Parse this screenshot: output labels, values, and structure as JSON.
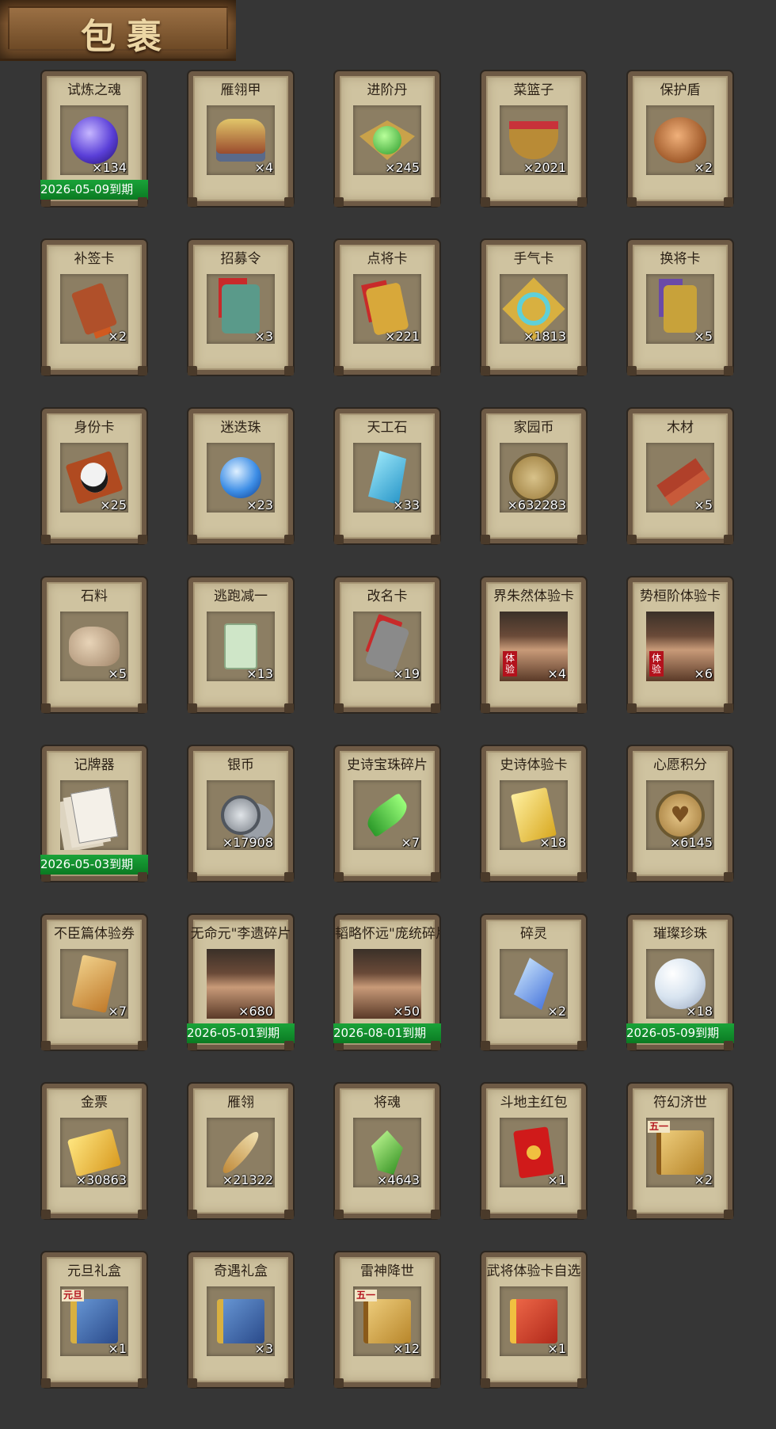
{
  "header": {
    "title": "包裹"
  },
  "items": [
    {
      "name": "试炼之魂",
      "qty": "×134",
      "expiry": "2026-05-09到期",
      "icon": "spirit-orb-icon"
    },
    {
      "name": "雁翎甲",
      "qty": "×4",
      "icon": "armor-helmet-icon"
    },
    {
      "name": "进阶丹",
      "qty": "×245",
      "icon": "green-pill-icon"
    },
    {
      "name": "菜篮子",
      "qty": "×2021",
      "icon": "basket-icon"
    },
    {
      "name": "保护盾",
      "qty": "×2",
      "icon": "shield-icon"
    },
    {
      "name": "补签卡",
      "qty": "×2",
      "icon": "sign-token-icon"
    },
    {
      "name": "招募令",
      "qty": "×3",
      "icon": "recruit-token-icon"
    },
    {
      "name": "点将卡",
      "qty": "×221",
      "icon": "general-token-icon"
    },
    {
      "name": "手气卡",
      "qty": "×1813",
      "icon": "luck-card-icon"
    },
    {
      "name": "换将卡",
      "qty": "×5",
      "icon": "swap-token-icon"
    },
    {
      "name": "身份卡",
      "qty": "×25",
      "icon": "opera-mask-icon"
    },
    {
      "name": "迷迭珠",
      "qty": "×23",
      "icon": "blue-orb-icon"
    },
    {
      "name": "天工石",
      "qty": "×33",
      "icon": "crystal-icon"
    },
    {
      "name": "家园币",
      "qty": "×632283",
      "icon": "home-coin-icon"
    },
    {
      "name": "木材",
      "qty": "×5",
      "icon": "wood-icon"
    },
    {
      "name": "石料",
      "qty": "×5",
      "icon": "stone-icon"
    },
    {
      "name": "逃跑减一",
      "qty": "×13",
      "icon": "jade-tag-icon"
    },
    {
      "name": "改名卡",
      "qty": "×19",
      "icon": "rename-token-icon"
    },
    {
      "name": "界朱然体验卡",
      "qty": "×4",
      "icon": "general-portrait-icon",
      "tag": "体验"
    },
    {
      "name": "势桓阶体验卡",
      "qty": "×6",
      "icon": "general-portrait-icon",
      "tag": "体验"
    },
    {
      "name": "记牌器",
      "qty": "",
      "expiry": "2026-05-03到期",
      "icon": "playing-cards-icon"
    },
    {
      "name": "银币",
      "qty": "×17908",
      "icon": "silver-coins-icon"
    },
    {
      "name": "史诗宝珠碎片",
      "qty": "×7",
      "icon": "jade-shard-icon"
    },
    {
      "name": "史诗体验卡",
      "qty": "×18",
      "icon": "gold-card-icon"
    },
    {
      "name": "心愿积分",
      "qty": "×6145",
      "icon": "heart-coin-icon"
    },
    {
      "name": "不臣篇体验券",
      "qty": "×7",
      "icon": "ticket-icon"
    },
    {
      "name": "无命元\"李遗碎片",
      "qty": "×680",
      "expiry": "2026-05-01到期",
      "icon": "general-portrait-icon"
    },
    {
      "name": "韬略怀远\"庞统碎片",
      "qty": "×50",
      "expiry": "2026-08-01到期",
      "icon": "general-portrait-icon"
    },
    {
      "name": "碎灵",
      "qty": "×2",
      "icon": "blue-crystal-shard-icon"
    },
    {
      "name": "璀璨珍珠",
      "qty": "×18",
      "expiry": "2026-05-09到期",
      "icon": "pearl-icon"
    },
    {
      "name": "金票",
      "qty": "×30863",
      "icon": "gold-ticket-icon"
    },
    {
      "name": "雁翎",
      "qty": "×21322",
      "icon": "feather-icon"
    },
    {
      "name": "将魂",
      "qty": "×4643",
      "icon": "green-soul-icon"
    },
    {
      "name": "斗地主红包",
      "qty": "×1",
      "icon": "red-envelope-icon"
    },
    {
      "name": "符幻济世",
      "qty": "×2",
      "icon": "gift-box-gold-icon",
      "label": "五一"
    },
    {
      "name": "元旦礼盒",
      "qty": "×1",
      "icon": "gift-box-blue-icon",
      "label": "元旦"
    },
    {
      "name": "奇遇礼盒",
      "qty": "×3",
      "icon": "gift-box-blue-icon"
    },
    {
      "name": "雷神降世",
      "qty": "×12",
      "icon": "gift-box-gold-icon",
      "label": "五一"
    },
    {
      "name": "武将体验卡自选",
      "qty": "×1",
      "icon": "gift-box-red-icon"
    }
  ],
  "colors": {
    "background": "#363636",
    "card": "#cfc3a0",
    "frame": "#6e5a45",
    "expiry_bar": "#0b7a22"
  }
}
